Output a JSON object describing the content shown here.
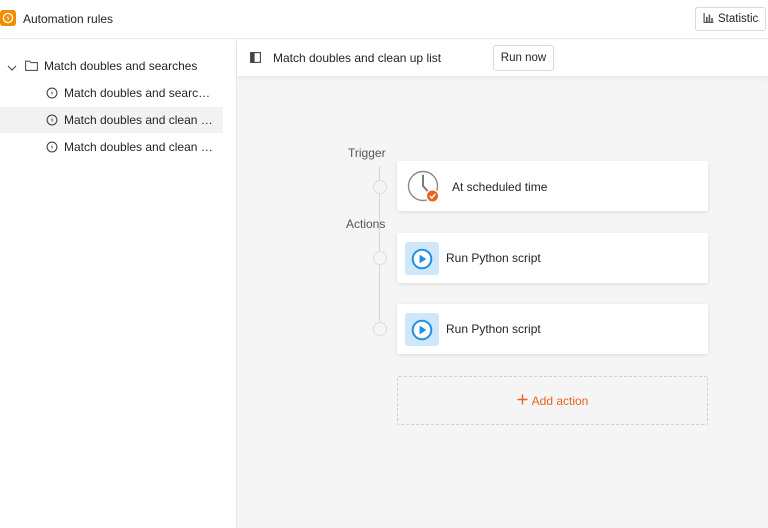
{
  "header": {
    "app_title": "Automation rules",
    "statistic_label": "Statistic"
  },
  "sidebar": {
    "folder": {
      "label": "Match doubles and searches"
    },
    "rules": [
      {
        "label": "Match doubles and searches",
        "active": false
      },
      {
        "label": "Match doubles and clean up list",
        "active": true
      },
      {
        "label": "Match doubles and clean up list",
        "active": false
      }
    ]
  },
  "main": {
    "rule_title": "Match doubles and clean up list",
    "run_now_label": "Run now",
    "trigger_section": "Trigger",
    "actions_section": "Actions",
    "trigger": {
      "label": "At scheduled time",
      "icon": "clock-icon"
    },
    "actions": [
      {
        "label": "Run Python script",
        "icon": "play-icon"
      },
      {
        "label": "Run Python script",
        "icon": "play-icon"
      }
    ],
    "add_action_label": "Add action"
  },
  "colors": {
    "accent": "#e8641e",
    "brand": "#f28c00",
    "play": "#1e90e6",
    "play_tile": "#cfe7fb"
  }
}
